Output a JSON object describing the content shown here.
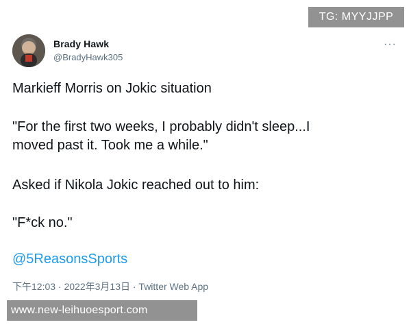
{
  "watermark": {
    "top": "TG: MYYJJPP",
    "bottom": "www.new-leihuoesport.com"
  },
  "tweet": {
    "author_name": "Brady Hawk",
    "author_handle": "@BradyHawk305",
    "more_icon": "more-options-icon",
    "more_glyph": "···",
    "lines": [
      "Markieff Morris on Jokic situation",
      "\"For the first two weeks, I probably didn't sleep...I",
      "moved past it. Took me a while.\"",
      "Asked if Nikola Jokic reached out to him:",
      "\"F*ck no.\""
    ],
    "mention": "@5ReasonsSports",
    "meta": "下午12:03 · 2022年3月13日 · Twitter Web App"
  },
  "colors": {
    "text": "#0f1419",
    "secondary": "#5b7083",
    "link": "#1d9bf0",
    "watermark_bg": "#737373"
  }
}
